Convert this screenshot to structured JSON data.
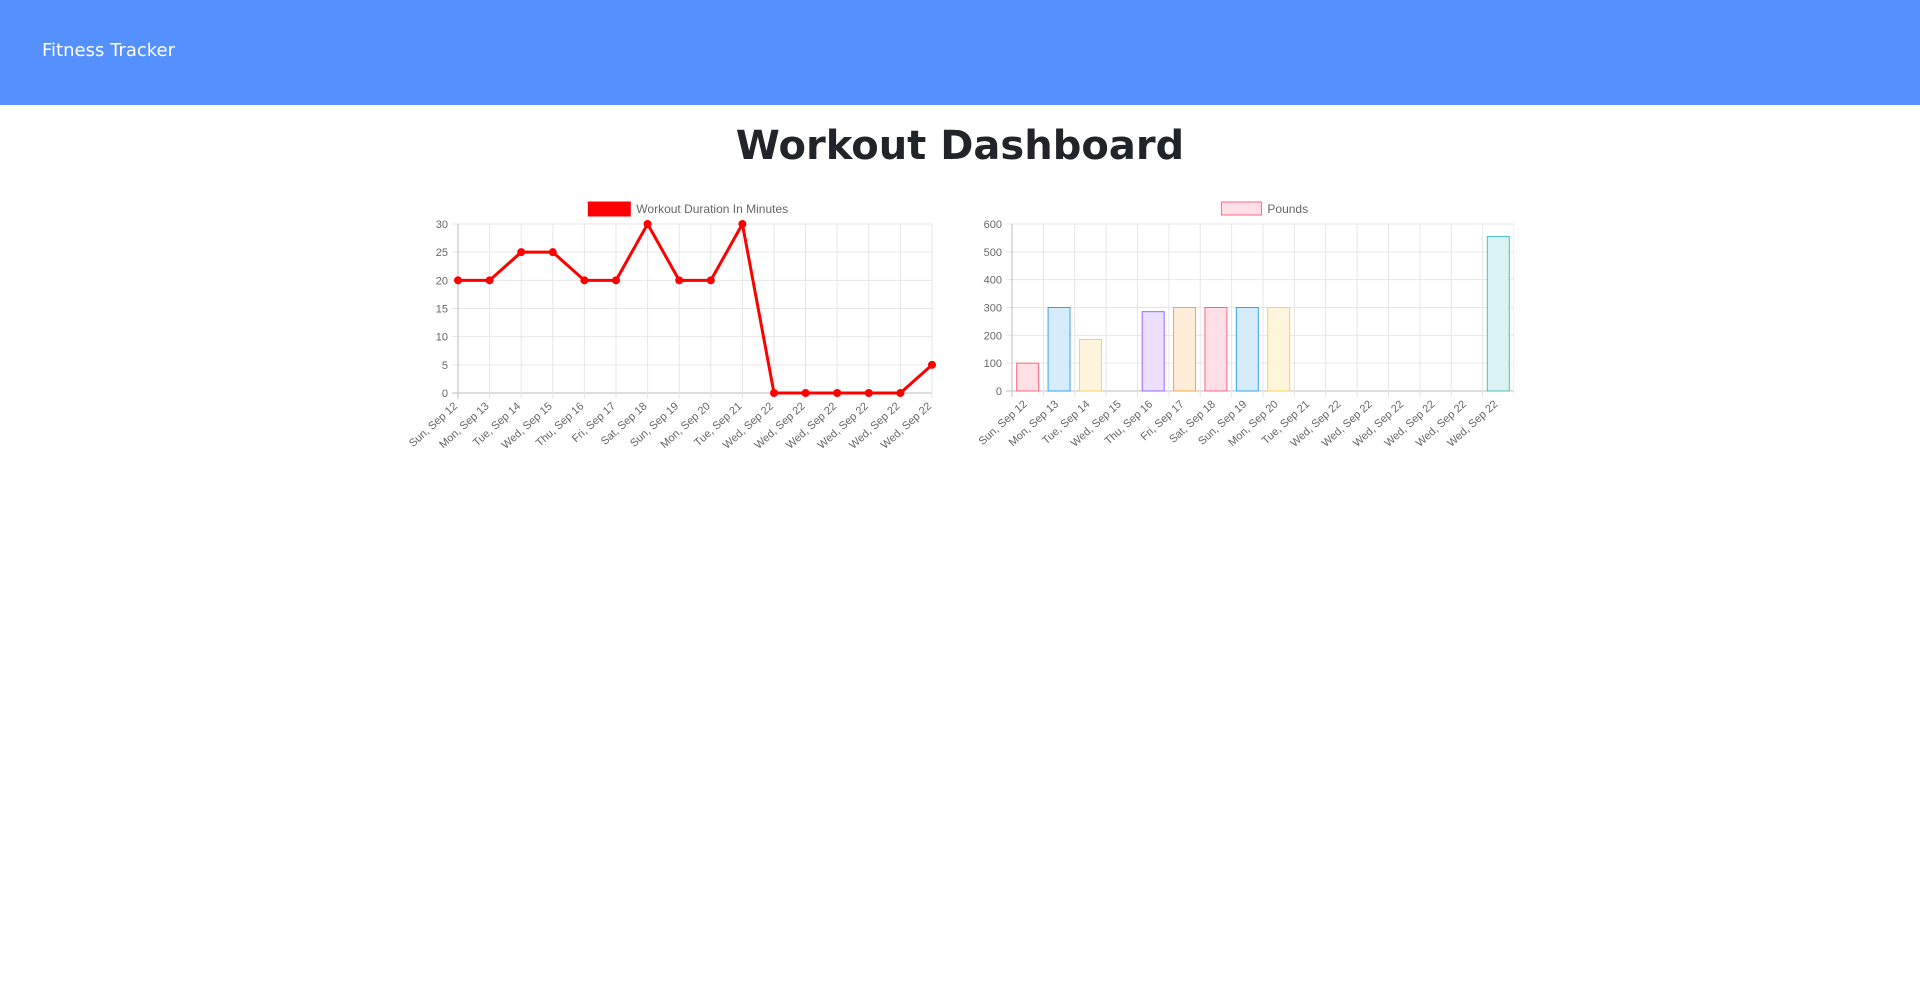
{
  "navbar": {
    "brand": "Fitness Tracker",
    "bg_color": "#5591fe"
  },
  "page": {
    "title": "Workout Dashboard"
  },
  "chart_data": [
    {
      "type": "line",
      "legend": "Workout Duration In Minutes",
      "legend_position": "top",
      "grid": true,
      "color": "#ff0000",
      "categories": [
        "Sun, Sep 12",
        "Mon, Sep 13",
        "Tue, Sep 14",
        "Wed, Sep 15",
        "Thu, Sep 16",
        "Fri, Sep 17",
        "Sat, Sep 18",
        "Sun, Sep 19",
        "Mon, Sep 20",
        "Tue, Sep 21",
        "Wed, Sep 22",
        "Wed, Sep 22",
        "Wed, Sep 22",
        "Wed, Sep 22",
        "Wed, Sep 22",
        "Wed, Sep 22"
      ],
      "values": [
        20,
        20,
        25,
        25,
        20,
        20,
        30,
        20,
        20,
        30,
        0,
        0,
        0,
        0,
        0,
        5
      ],
      "ylim": [
        0,
        30
      ],
      "yticks": [
        0,
        5,
        10,
        15,
        20,
        25,
        30
      ]
    },
    {
      "type": "bar",
      "legend": "Pounds",
      "legend_position": "top",
      "grid": true,
      "categories": [
        "Sun, Sep 12",
        "Mon, Sep 13",
        "Tue, Sep 14",
        "Wed, Sep 15",
        "Thu, Sep 16",
        "Fri, Sep 17",
        "Sat, Sep 18",
        "Sun, Sep 19",
        "Mon, Sep 20",
        "Tue, Sep 21",
        "Wed, Sep 22",
        "Wed, Sep 22",
        "Wed, Sep 22",
        "Wed, Sep 22",
        "Wed, Sep 22",
        "Wed, Sep 22"
      ],
      "values": [
        100,
        300,
        185,
        0,
        285,
        300,
        300,
        300,
        300,
        0,
        0,
        0,
        0,
        0,
        0,
        555
      ],
      "bar_fill_colors": [
        "#ffe0e6",
        "#d7ecfb",
        "#fff5dd",
        "#ebe0ff",
        "#ebe0ff",
        "#ffecd9",
        "#ffe0e6",
        "#d7ecfb",
        "#fff5dd",
        "#dbf2f2",
        "#ffe0e6",
        "#d7ecfb",
        "#fff5dd",
        "#ebe0ff",
        "#ffecd9",
        "#dbf2f2"
      ],
      "bar_stroke_colors": [
        "#ff6384",
        "#36a2eb",
        "#ffce56",
        "#9966ff",
        "#9966ff",
        "#ff9f40",
        "#ff6384",
        "#36a2eb",
        "#ffce56",
        "#4bc0c0",
        "#ff6384",
        "#36a2eb",
        "#ffce56",
        "#9966ff",
        "#ff9f40",
        "#4bc0c0"
      ],
      "ylim": [
        0,
        600
      ],
      "yticks": [
        0,
        100,
        200,
        300,
        400,
        500,
        600
      ]
    }
  ]
}
